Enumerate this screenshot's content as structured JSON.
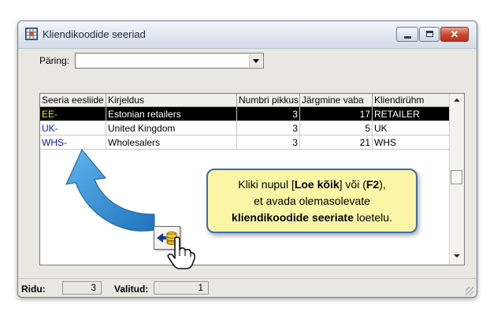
{
  "window": {
    "title": "Kliendikoodide seeriad",
    "close_glyph": "✕"
  },
  "query": {
    "label": "Päring:",
    "value": ""
  },
  "grid": {
    "columns": [
      "Seeria eesliide",
      "Kirjeldus",
      "Numbri pikkus",
      "Järgmine vaba",
      "Kliendirühm"
    ],
    "rows": [
      [
        "EE-",
        "Estonian retailers",
        "3",
        "17",
        "RETAILER"
      ],
      [
        "UK-",
        "United Kingdom",
        "3",
        "5",
        "UK"
      ],
      [
        "WHS-",
        "Wholesalers",
        "3",
        "21",
        "WHS"
      ]
    ],
    "selected_row": 0
  },
  "status": {
    "rows_label": "Ridu:",
    "rows_value": "3",
    "selected_label": "Valitud:",
    "selected_value": "1"
  },
  "callout": {
    "line1_pre": "Kliki nupul [",
    "line1_bold1": "Loe kõik",
    "line1_mid": "] või (",
    "line1_bold2": "F2",
    "line1_post": "),",
    "line2": "et avada olemasolevate",
    "line3_bold": "kliendikoodide  seeriate",
    "line3_post": " loetelu."
  },
  "icons": {
    "app": "grid-window-icon",
    "load_all": "load-all-icon",
    "pointer": "hand-pointer-icon"
  },
  "colors": {
    "code_text": "#1010d0",
    "selected_code_text": "#f2e600",
    "callout_bg": "#fbf6a6",
    "arrow_blue": "#2f8fd6"
  }
}
